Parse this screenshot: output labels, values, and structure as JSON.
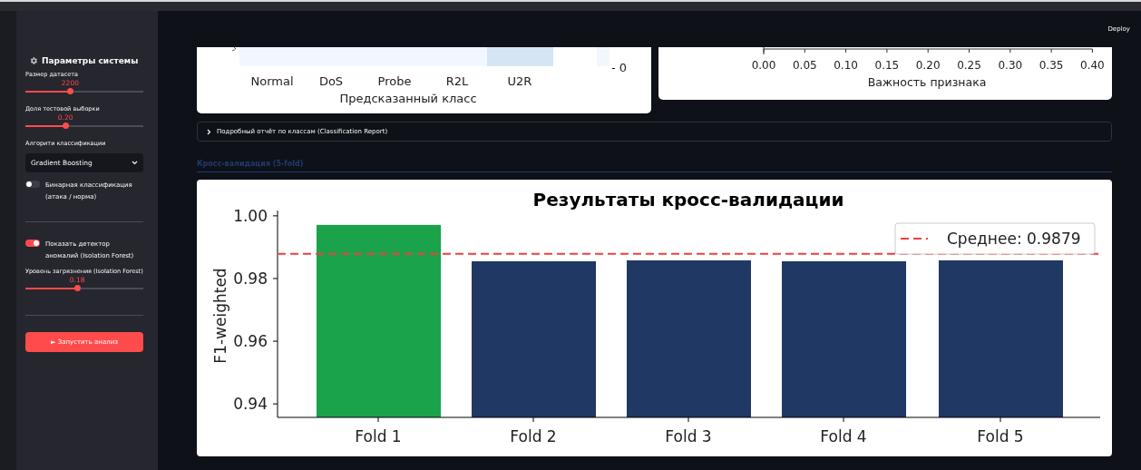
{
  "header": {
    "deploy": "Deploy"
  },
  "sidebar": {
    "title": "Параметры системы",
    "controls": [
      {
        "kind": "slider",
        "label": "Размер датасета",
        "reading": "2200",
        "level": 0.38
      },
      {
        "kind": "slider",
        "label": "Доля тестовой выборки",
        "reading": "0.20",
        "level": 0.34
      },
      {
        "kind": "select",
        "label": "Алгорити классификации",
        "value": "Gradient Boosting"
      },
      {
        "kind": "toggle",
        "label": "Бинарная классификация (атака / норма)",
        "on": false
      },
      {
        "kind": "divider"
      },
      {
        "kind": "toggle",
        "label": "Показать детектор аномалий (Isolation Forest)",
        "on": true
      },
      {
        "kind": "slider",
        "label": "Уровень загрязнения (Isolation Forest)",
        "reading": "0.18",
        "level": 0.44
      },
      {
        "kind": "divider"
      }
    ],
    "run_button": "► Запустить анализ"
  },
  "confusion_matrix": {
    "xticks": [
      "Normal",
      "DoS",
      "Probe",
      "R2L",
      "U2R"
    ],
    "xlabel": "Предсказанный класс",
    "colorbar_tick": "- 0"
  },
  "importance_chart": {
    "xticks": [
      "0.00",
      "0.05",
      "0.10",
      "0.15",
      "0.20",
      "0.25",
      "0.30",
      "0.35",
      "0.40"
    ],
    "xlabel": "Важность признака"
  },
  "expander": {
    "label": "Подробный отчёт по классам (Classification Report)",
    "expanded": false
  },
  "section_heading": "Кросс-валидация (5-fold)",
  "cv_chart": {
    "chart_data": {
      "type": "bar",
      "title": "Результаты кросс-валидации",
      "ylabel": "F1-weighted",
      "categories": [
        "Fold 1",
        "Fold 2",
        "Fold 3",
        "Fold 4",
        "Fold 5"
      ],
      "series": [
        {
          "color": "#1aa34a",
          "values": [
            0.9971,
            null,
            null,
            null,
            null
          ]
        },
        {
          "color": "#203864",
          "values": [
            null,
            0.9855,
            0.9858,
            0.9855,
            0.9858
          ]
        }
      ],
      "ylim": [
        0.9357,
        1.0017
      ],
      "yticks": [
        {
          "value": 0.94,
          "label": "0.94"
        },
        {
          "value": 0.96,
          "label": "0.96"
        },
        {
          "value": 0.98,
          "label": "0.98"
        },
        {
          "value": 1.0,
          "label": "1.00"
        }
      ],
      "ref_lines": [
        {
          "axis": "y",
          "value": 0.9879,
          "label": "Среднее: 0.9879",
          "color": "#f04040"
        }
      ]
    }
  }
}
